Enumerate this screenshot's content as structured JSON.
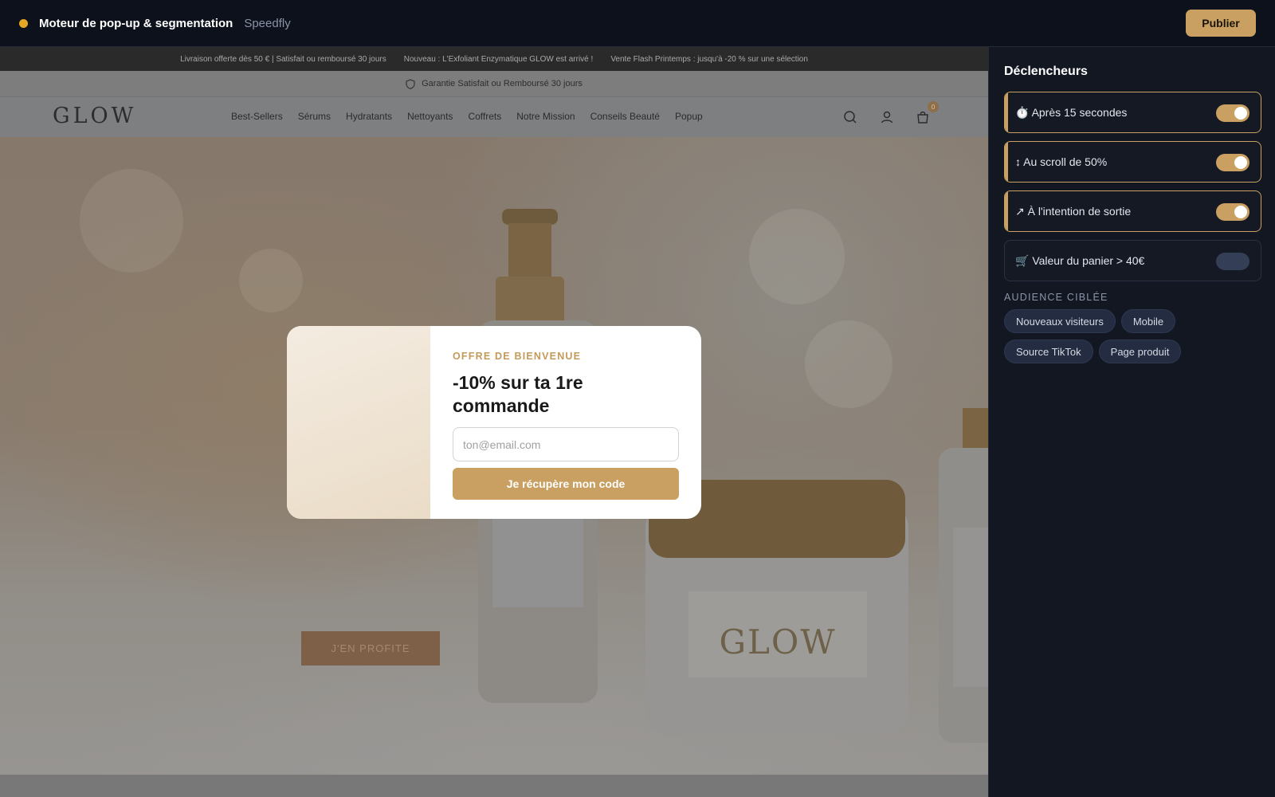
{
  "topbar": {
    "title": "Moteur de pop-up & segmentation",
    "subtitle": "Speedfly",
    "publish_label": "Publier",
    "status_color": "#e7a726"
  },
  "preview": {
    "promo_messages": [
      "Livraison offerte dès 50 € | Satisfait ou remboursé 30 jours",
      "Nouveau : L'Exfoliant Enzymatique GLOW est arrivé !",
      "Vente Flash Printemps : jusqu'à -20 % sur une sélection"
    ],
    "guarantee": "Garantie Satisfait ou Remboursé 30 jours",
    "logo": "GLOW",
    "nav": [
      "Best-Sellers",
      "Sérums",
      "Hydratants",
      "Nettoyants",
      "Coffrets",
      "Notre Mission",
      "Conseils Beauté",
      "Popup"
    ],
    "cart_count": "0",
    "product_label": "GLOW",
    "hero_cta": "J'EN PROFITE"
  },
  "popup": {
    "eyebrow": "OFFRE DE BIENVENUE",
    "title": "-10% sur ta 1re commande",
    "email_placeholder": "ton@email.com",
    "cta": "Je récupère mon code"
  },
  "panel": {
    "title": "Déclencheurs",
    "triggers": [
      {
        "icon": "⏱️",
        "label": "Après 15 secondes",
        "enabled": true
      },
      {
        "icon": "↕",
        "label": "Au scroll de 50%",
        "enabled": true
      },
      {
        "icon": "↗",
        "label": "À l'intention de sortie",
        "enabled": true
      },
      {
        "icon": "🛒",
        "label": "Valeur du panier > 40€",
        "enabled": false
      }
    ],
    "audience_label": "AUDIENCE CIBLÉE",
    "audience": [
      "Nouveaux visiteurs",
      "Mobile",
      "Source TikTok",
      "Page produit"
    ]
  },
  "colors": {
    "accent": "#c9a061",
    "background": "#0d111a",
    "panel": "#121722"
  }
}
